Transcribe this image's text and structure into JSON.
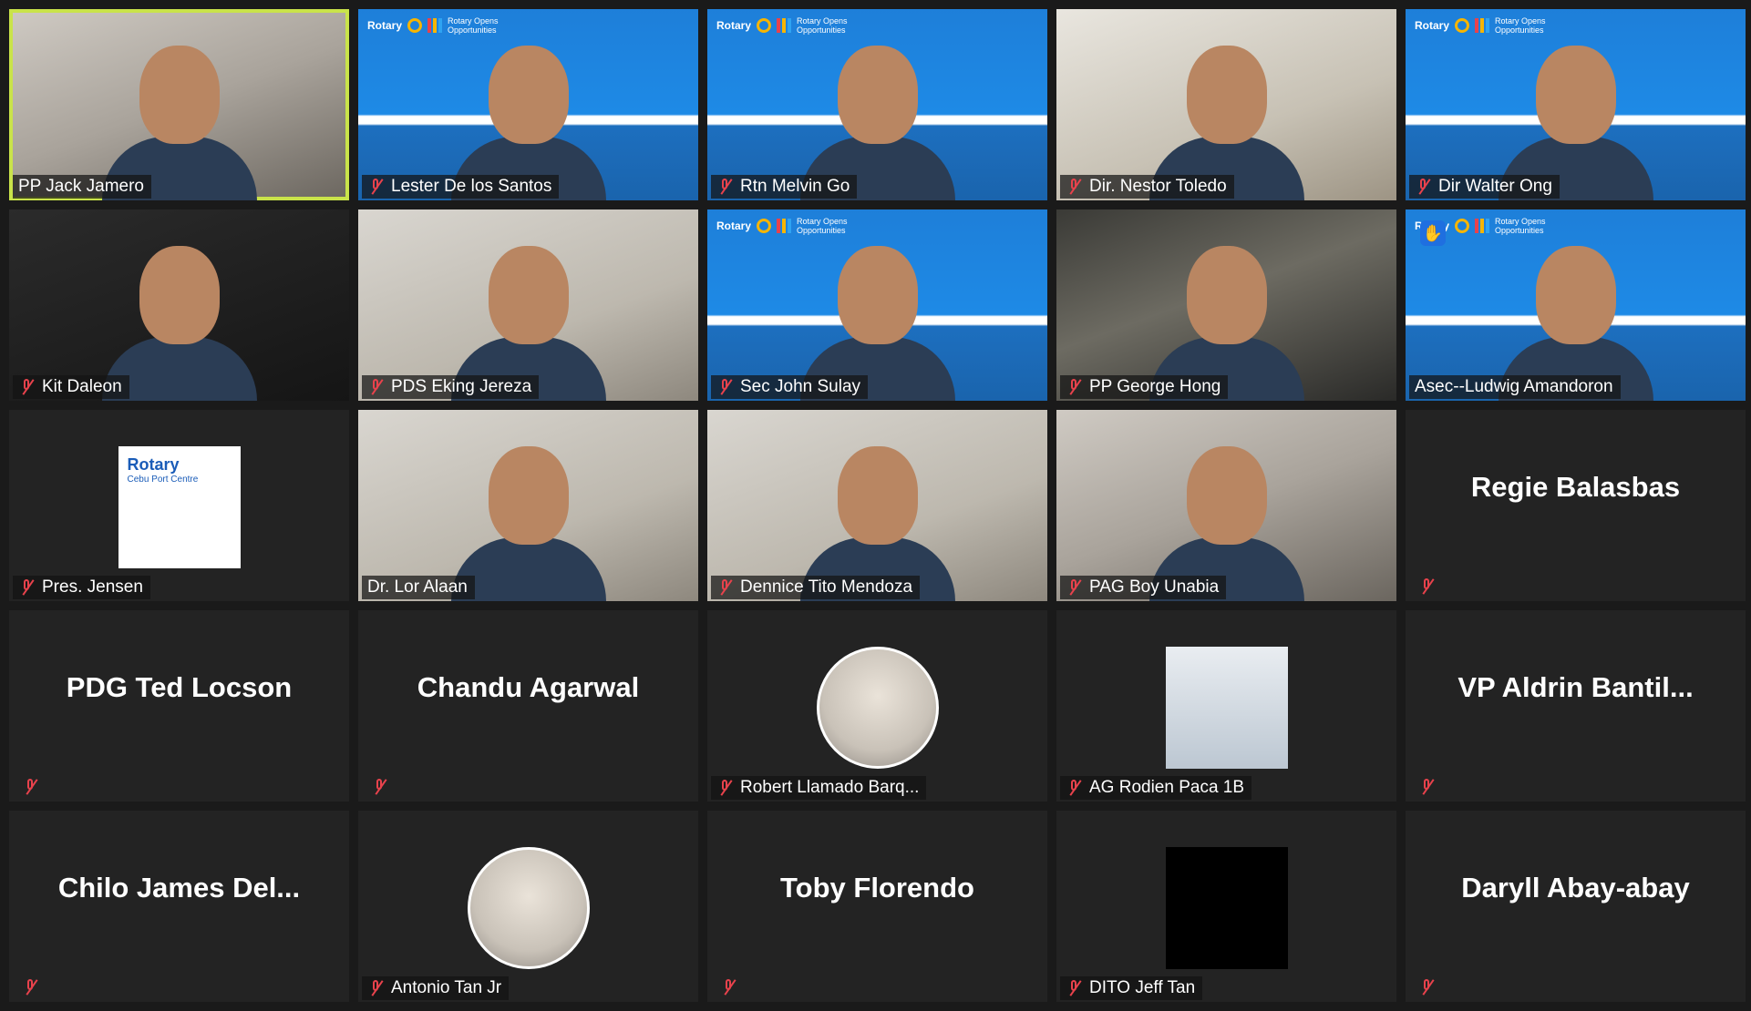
{
  "tiles": [
    {
      "name": "PP Jack Jamero",
      "type": "video",
      "bg": "bg-room",
      "muted": false,
      "active": true,
      "banner": false
    },
    {
      "name": "Lester De los Santos",
      "type": "video",
      "bg": "bg-rotary",
      "muted": true,
      "banner": true
    },
    {
      "name": "Rtn Melvin Go",
      "type": "video",
      "bg": "bg-rotary",
      "muted": true,
      "banner": true
    },
    {
      "name": "Dir. Nestor Toledo",
      "type": "video",
      "bg": "bg-cafe",
      "muted": true,
      "banner": false
    },
    {
      "name": "Dir Walter Ong",
      "type": "video",
      "bg": "bg-rotary",
      "muted": true,
      "banner": true
    },
    {
      "name": "Kit Daleon",
      "type": "video",
      "bg": "bg-dark",
      "muted": true,
      "banner": false
    },
    {
      "name": "PDS Eking Jereza",
      "type": "video",
      "bg": "bg-wall",
      "muted": true,
      "banner": false
    },
    {
      "name": "Sec John Sulay",
      "type": "video",
      "bg": "bg-rotary",
      "muted": true,
      "banner": true
    },
    {
      "name": "PP George Hong",
      "type": "video",
      "bg": "bg-office",
      "muted": true,
      "banner": false
    },
    {
      "name": "Asec--Ludwig Amandoron",
      "type": "video",
      "bg": "bg-rotary",
      "muted": false,
      "banner": true,
      "raised_hand": true
    },
    {
      "name": "Pres. Jensen",
      "type": "avatar",
      "avatar": "rotary",
      "muted": true
    },
    {
      "name": "Dr. Lor Alaan",
      "type": "video",
      "bg": "bg-wall",
      "muted": false,
      "banner": false
    },
    {
      "name": "Dennice Tito Mendoza",
      "type": "video",
      "bg": "bg-wall",
      "muted": true,
      "banner": false
    },
    {
      "name": "PAG Boy Unabia",
      "type": "video",
      "bg": "bg-room",
      "muted": true,
      "banner": false
    },
    {
      "name": "Regie Balasbas",
      "type": "nameonly",
      "muted": true
    },
    {
      "name": "PDG Ted Locson",
      "type": "nameonly",
      "muted": true
    },
    {
      "name": "Chandu Agarwal",
      "type": "nameonly",
      "muted": true
    },
    {
      "name": "Robert Llamado Barq...",
      "type": "avatar",
      "avatar": "circle",
      "muted": true
    },
    {
      "name": "AG Rodien Paca 1B",
      "type": "avatar",
      "avatar": "photo",
      "muted": true
    },
    {
      "name": "VP  Aldrin  Bantil...",
      "type": "nameonly",
      "muted": true
    },
    {
      "name": "Chilo  James  Del...",
      "type": "nameonly",
      "muted": true
    },
    {
      "name": "Antonio Tan Jr",
      "type": "avatar",
      "avatar": "circle",
      "muted": true
    },
    {
      "name": "Toby Florendo",
      "type": "nameonly",
      "muted": true
    },
    {
      "name": "DITO Jeff Tan",
      "type": "avatar",
      "avatar": "black",
      "muted": true
    },
    {
      "name": "Daryll Abay-abay",
      "type": "nameonly",
      "muted": true
    }
  ],
  "banner_text": {
    "brand": "Rotary",
    "tagline": "Rotary Opens Opportunities",
    "avatar_brand": "Rotary",
    "avatar_sub": "Cebu Port Centre"
  },
  "colors": {
    "active_border": "#c9e34a",
    "muted_icon": "#e8424c",
    "tile_bg": "#232323"
  }
}
